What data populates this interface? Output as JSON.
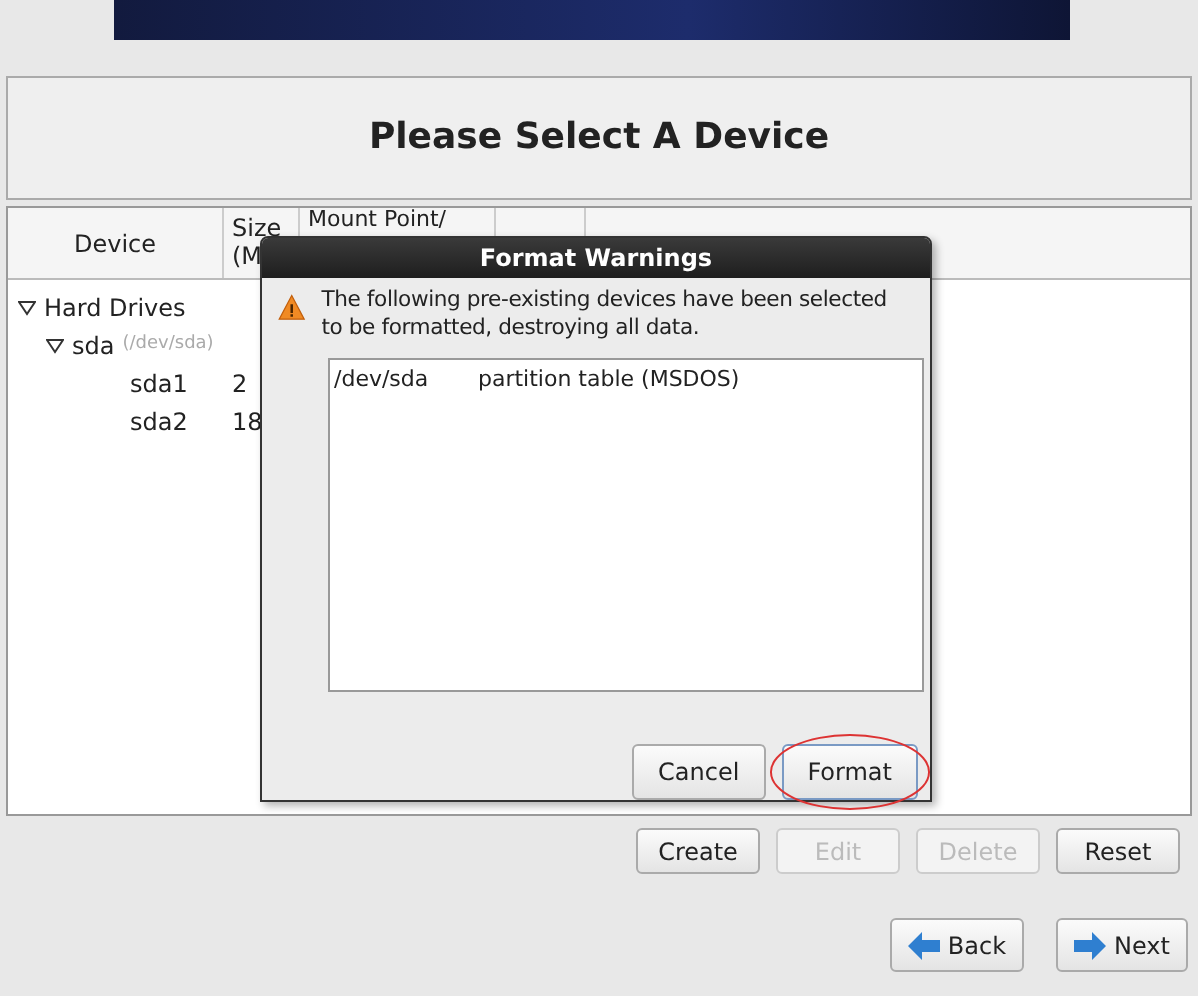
{
  "title": "Please Select A Device",
  "table": {
    "columns": [
      "Device",
      "Size (M",
      "Mount Point/"
    ],
    "rows": [
      {
        "device": "Hard Drives",
        "expanded": true,
        "children": [
          {
            "device": "sda",
            "path": "(/dev/sda)",
            "expanded": true,
            "children": [
              {
                "device": "sda1",
                "size": "2"
              },
              {
                "device": "sda2",
                "size": "18"
              }
            ]
          }
        ]
      }
    ]
  },
  "dialog": {
    "title": "Format Warnings",
    "message": "The following pre-existing devices have been selected to be formatted, destroying all data.",
    "items": [
      {
        "device": "/dev/sda",
        "description": "partition table (MSDOS)"
      }
    ],
    "buttons": [
      {
        "label": "Cancel",
        "focused": false,
        "circled": false
      },
      {
        "label": "Format",
        "focused": true,
        "circled": true
      }
    ]
  },
  "actions": [
    {
      "label": "Create",
      "disabled": false
    },
    {
      "label": "Edit",
      "disabled": true
    },
    {
      "label": "Delete",
      "disabled": true
    },
    {
      "label": "Reset",
      "disabled": false
    }
  ],
  "navigation": [
    {
      "label": "Back",
      "kind": "back"
    },
    {
      "label": "Next",
      "kind": "next"
    }
  ]
}
